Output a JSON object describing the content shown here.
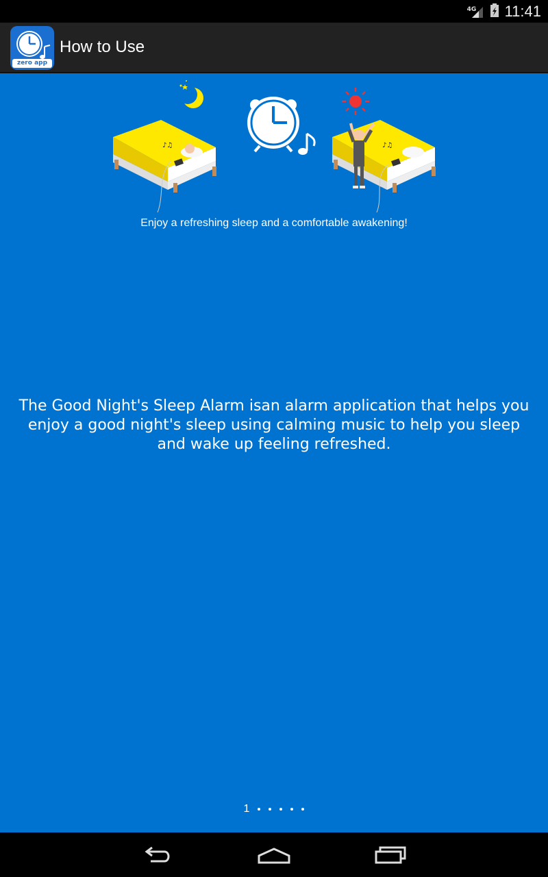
{
  "status_bar": {
    "network": "4G",
    "time": "11:41",
    "icons": [
      "signal-icon",
      "battery-icon"
    ]
  },
  "action_bar": {
    "title": "How to Use",
    "app_icon": "alarm-clock-icon",
    "app_icon_text": "zero app"
  },
  "content": {
    "caption": "Enjoy a refreshing sleep and a comfortable awakening!",
    "description": "The Good Night's Sleep Alarm isan alarm application that helps you enjoy a good night's sleep using calming music to help you sleep and wake up feeling refreshed.",
    "pager": {
      "current": "1",
      "total_pages": 6,
      "current_index": 0
    }
  },
  "nav_bar": {
    "back": "back-icon",
    "home": "home-icon",
    "recents": "recents-icon"
  },
  "colors": {
    "background": "#0073d1",
    "action_bar": "#222222",
    "bed_yellow": "#ffe800",
    "sun_red": "#ee3333"
  }
}
